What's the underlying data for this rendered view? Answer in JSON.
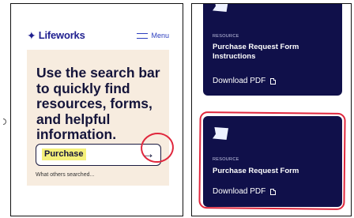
{
  "left_screen": {
    "logo_mark": "✦",
    "logo_text": "Lifeworks",
    "menu_label": "Menu",
    "hero_title": "Use the search bar to quickly find resources, forms, and helpful information.",
    "search_value": "Purchase",
    "search_arrow": "→",
    "search_hint": "What others searched..."
  },
  "right_screen": {
    "cards": [
      {
        "type": "RESOURCE",
        "title": "Purchase Request Form Instructions",
        "link": "Download PDF"
      },
      {
        "type": "RESOURCE",
        "title": "Purchase Request Form",
        "link": "Download PDF"
      }
    ]
  },
  "colors": {
    "brand": "#1f1f8f",
    "hero_bg": "#f7ecdf",
    "card_bg": "#10104a",
    "highlight": "#f5f07a",
    "annotation": "#e0273d"
  }
}
